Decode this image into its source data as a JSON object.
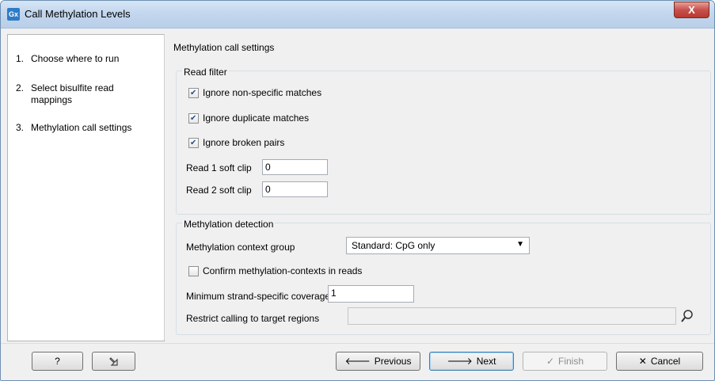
{
  "window": {
    "title": "Call Methylation Levels",
    "app_icon_text": "Gx",
    "close_glyph": "X"
  },
  "steps": [
    {
      "num": "1.",
      "label": "Choose where to run"
    },
    {
      "num": "2.",
      "label": "Select bisulfite read mappings"
    },
    {
      "num": "3.",
      "label": "Methylation call settings"
    }
  ],
  "content": {
    "section_title": "Methylation call settings",
    "read_filter": {
      "title": "Read filter",
      "ignore_nonspecific": {
        "label": "Ignore non-specific matches",
        "checked": true
      },
      "ignore_duplicate": {
        "label": "Ignore duplicate matches",
        "checked": true
      },
      "ignore_broken": {
        "label": "Ignore broken pairs",
        "checked": true
      },
      "read1_softclip": {
        "label": "Read 1 soft clip",
        "value": "0"
      },
      "read2_softclip": {
        "label": "Read 2 soft clip",
        "value": "0"
      }
    },
    "methylation_detection": {
      "title": "Methylation detection",
      "context_group": {
        "label": "Methylation context group",
        "value": "Standard: CpG only"
      },
      "confirm_contexts": {
        "label": "Confirm methylation-contexts in reads",
        "checked": false
      },
      "min_coverage": {
        "label": "Minimum strand-specific coverage",
        "value": "1"
      },
      "restrict_regions": {
        "label": "Restrict calling to target regions",
        "value": ""
      }
    }
  },
  "footer": {
    "help_label": "?",
    "previous_label": "Previous",
    "next_label": "Next",
    "finish_label": "Finish",
    "cancel_label": "Cancel"
  }
}
